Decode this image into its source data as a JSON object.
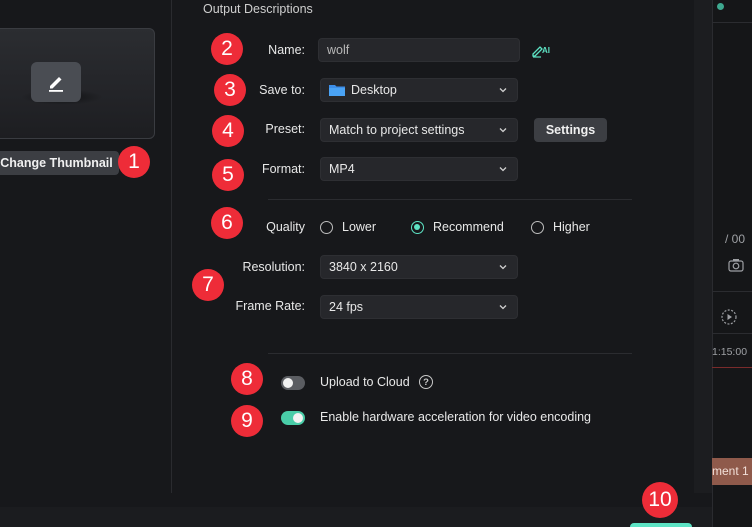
{
  "section_title": "Output Descriptions",
  "thumbnail": {
    "change_button": "Change Thumbnail",
    "icon": "pencil-icon"
  },
  "form": {
    "name_label": "Name:",
    "name_value": "wolf",
    "ai_icon_text": "AI",
    "save_to_label": "Save to:",
    "save_to_value": "Desktop",
    "preset_label": "Preset:",
    "preset_value": "Match to project settings",
    "settings_button": "Settings",
    "format_label": "Format:",
    "format_value": "MP4",
    "quality_label": "Quality",
    "quality_options": [
      "Lower",
      "Recommend",
      "Higher"
    ],
    "quality_selected": "Recommend",
    "resolution_label": "Resolution:",
    "resolution_value": "3840 x 2160",
    "frame_rate_label": "Frame Rate:",
    "frame_rate_value": "24 fps",
    "upload_cloud_label": "Upload to Cloud",
    "upload_cloud_on": false,
    "hw_accel_label": "Enable hardware acceleration for video encoding",
    "hw_accel_on": true
  },
  "badges": [
    "1",
    "2",
    "3",
    "4",
    "5",
    "6",
    "7",
    "8",
    "9",
    "10"
  ],
  "timeline": {
    "time_fragment": "/ 00",
    "timecode": "1:15:00",
    "clip_label": "ment 1"
  },
  "colors": {
    "accent": "#5de3c4",
    "badge": "#ee2c38",
    "background": "#17181b"
  }
}
